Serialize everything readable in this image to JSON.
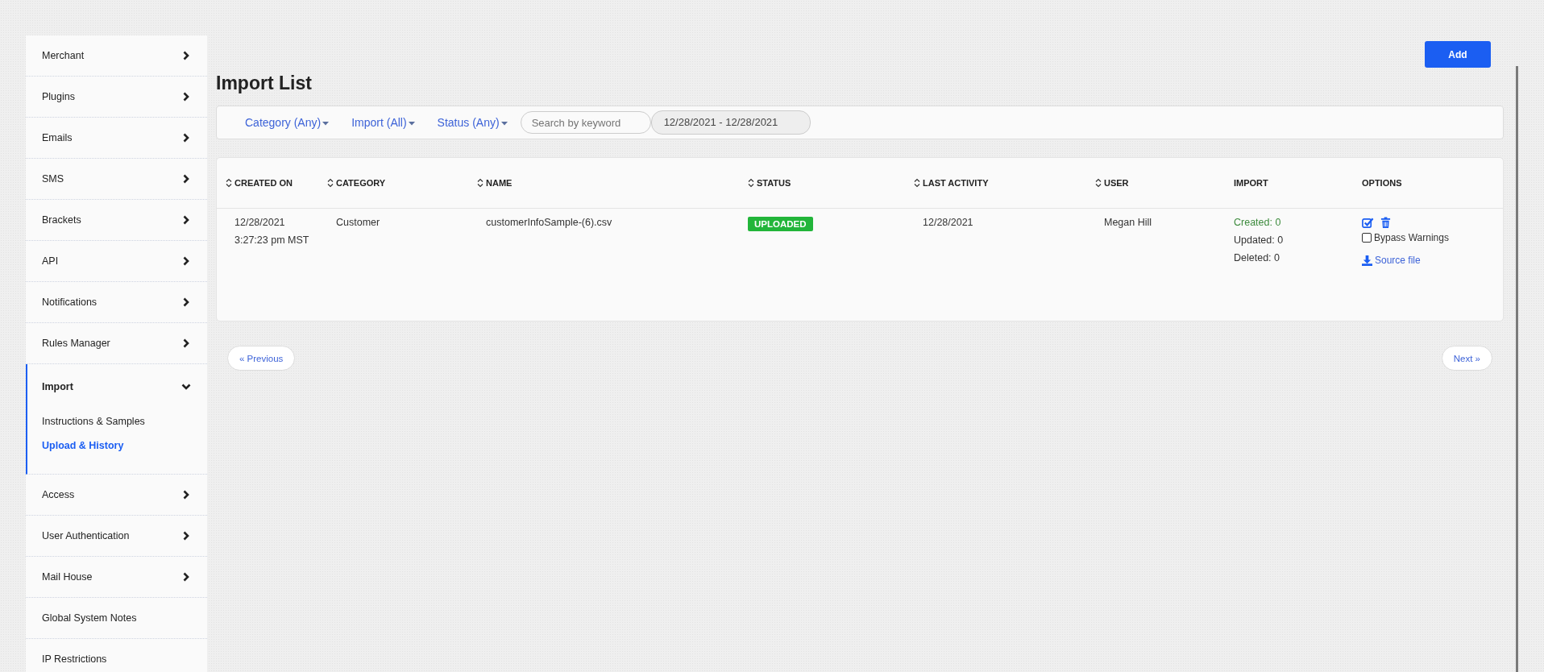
{
  "sidebar": {
    "items": [
      {
        "label": "Merchant",
        "has_children": true,
        "expanded": false
      },
      {
        "label": "Plugins",
        "has_children": true,
        "expanded": false
      },
      {
        "label": "Emails",
        "has_children": true,
        "expanded": false
      },
      {
        "label": "SMS",
        "has_children": true,
        "expanded": false
      },
      {
        "label": "Brackets",
        "has_children": true,
        "expanded": false
      },
      {
        "label": "API",
        "has_children": true,
        "expanded": false
      },
      {
        "label": "Notifications",
        "has_children": true,
        "expanded": false
      },
      {
        "label": "Rules Manager",
        "has_children": true,
        "expanded": false
      },
      {
        "label": "Import",
        "has_children": true,
        "expanded": true,
        "children": [
          {
            "label": "Instructions & Samples",
            "selected": false
          },
          {
            "label": "Upload & History",
            "selected": true
          }
        ]
      },
      {
        "label": "Access",
        "has_children": true,
        "expanded": false
      },
      {
        "label": "User Authentication",
        "has_children": true,
        "expanded": false
      },
      {
        "label": "Mail House",
        "has_children": true,
        "expanded": false
      },
      {
        "label": "Global System Notes",
        "has_children": false,
        "expanded": false
      },
      {
        "label": "IP Restrictions",
        "has_children": false,
        "expanded": false
      }
    ]
  },
  "add_button": "Add",
  "title": "Import List",
  "filters": {
    "dropdowns": [
      "Category (Any)",
      "Import (All)",
      "Status (Any)"
    ],
    "search": {
      "placeholder": "Search by keyword"
    },
    "date_range": "12/28/2021 - 12/28/2021"
  },
  "table": {
    "columns": [
      {
        "label": "CREATED ON",
        "sortable": true
      },
      {
        "label": "CATEGORY",
        "sortable": true
      },
      {
        "label": "NAME",
        "sortable": true
      },
      {
        "label": "STATUS",
        "sortable": true
      },
      {
        "label": "LAST ACTIVITY",
        "sortable": true
      },
      {
        "label": "USER",
        "sortable": true
      },
      {
        "label": "IMPORT",
        "sortable": false
      },
      {
        "label": "OPTIONS",
        "sortable": false
      }
    ],
    "rows": [
      {
        "created_on": [
          "12/28/2021",
          "3:27:23 pm MST"
        ],
        "category": "Customer",
        "name": "customerInfoSample-(6).csv",
        "status": {
          "text": "UPLOADED",
          "color": "#22b53a"
        },
        "last_activity": "12/28/2021",
        "user": "Megan Hill",
        "import": [
          {
            "text": "Created: 0",
            "color": "#3d8b3d"
          },
          {
            "text": "Updated: 0",
            "color": "#333333"
          },
          {
            "text": "Deleted: 0",
            "color": "#333333"
          }
        ],
        "options": {
          "bypass_warnings": {
            "label": "Bypass Warnings",
            "checked": false
          },
          "source_file": "Source file"
        }
      }
    ]
  },
  "pagination": {
    "previous": "« Previous",
    "next": "Next »"
  }
}
